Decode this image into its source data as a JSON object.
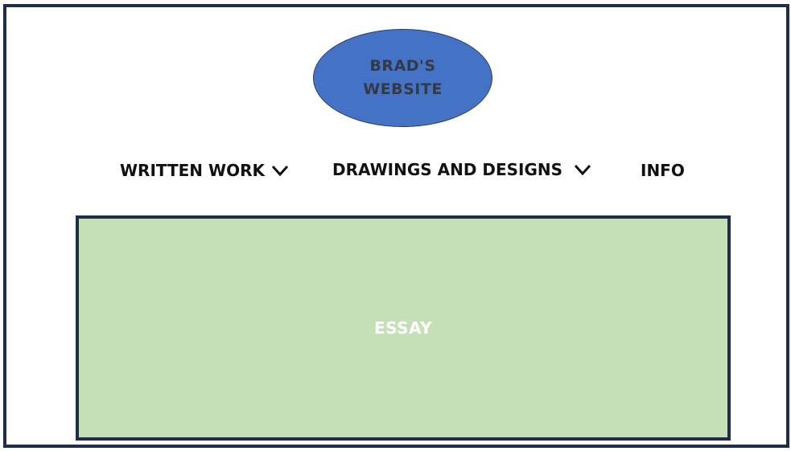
{
  "theme": {
    "frame_border": "#1f2d4a",
    "logo_fill": "#4472c4",
    "essay_fill": "#c5e0b4",
    "nav_text": "#111111"
  },
  "logo": {
    "line1": "BRAD'S",
    "line2": "WEBSITE"
  },
  "nav": {
    "items": [
      {
        "label": "WRITTEN WORK",
        "icon": "chevron-down-icon"
      },
      {
        "label": "DRAWINGS AND DESIGNS",
        "icon": "chevron-down-icon"
      },
      {
        "label": "INFO"
      }
    ]
  },
  "main": {
    "essay_label": "ESSAY"
  }
}
